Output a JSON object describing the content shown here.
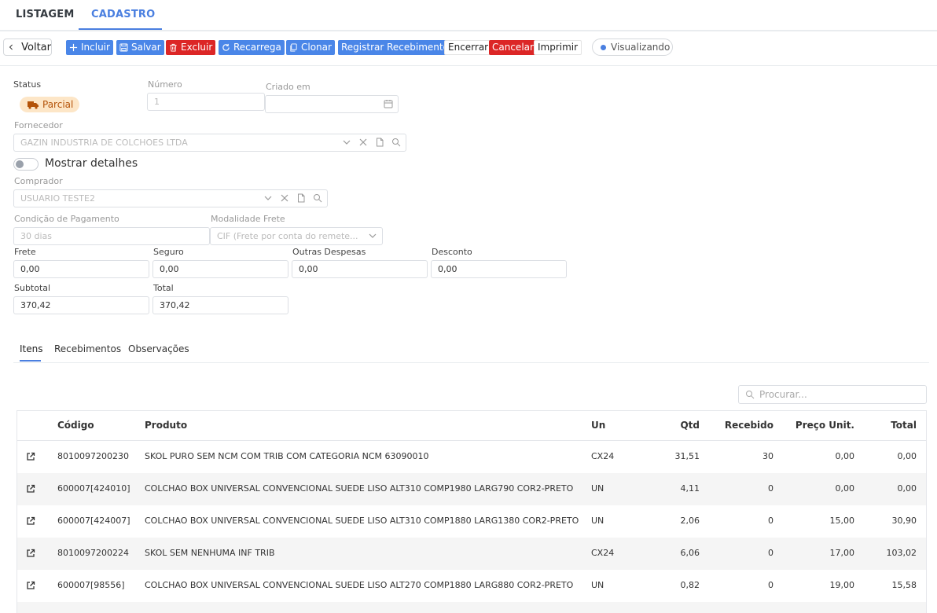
{
  "top_tabs": {
    "listagem": "LISTAGEM",
    "cadastro": "CADASTRO"
  },
  "toolbar": {
    "voltar": "Voltar",
    "incluir": "Incluir",
    "salvar": "Salvar",
    "excluir": "Excluir",
    "recarrega": "Recarrega",
    "clonar": "Clonar",
    "registrar": "Registrar Recebimento",
    "encerrar": "Encerrar",
    "cancelar": "Cancelar",
    "imprimir": "Imprimir",
    "mode": "Visualizando"
  },
  "form": {
    "status_label": "Status",
    "status_value": "Parcial",
    "numero_label": "Número",
    "numero_value": "1",
    "criado_label": "Criado em",
    "criado_value": "",
    "fornecedor_label": "Fornecedor",
    "fornecedor_value": "GAZIN INDUSTRIA DE COLCHOES LTDA",
    "mostrar_detalhes": "Mostrar detalhes",
    "comprador_label": "Comprador",
    "comprador_value": "USUARIO TESTE2",
    "condicao_label": "Condição de Pagamento",
    "condicao_value": "30 dias",
    "modalidade_label": "Modalidade Frete",
    "modalidade_value": "CIF (Frete por conta do remete...",
    "frete_label": "Frete",
    "frete_value": "0,00",
    "seguro_label": "Seguro",
    "seguro_value": "0,00",
    "outras_label": "Outras Despesas",
    "outras_value": "0,00",
    "desconto_label": "Desconto",
    "desconto_value": "0,00",
    "subtotal_label": "Subtotal",
    "subtotal_value": "370,42",
    "total_label": "Total",
    "total_value": "370,42"
  },
  "sub_tabs": {
    "itens": "Itens",
    "recebimentos": "Recebimentos",
    "observacoes": "Observações"
  },
  "search": {
    "placeholder": "Procurar..."
  },
  "table": {
    "headers": {
      "codigo": "Código",
      "produto": "Produto",
      "un": "Un",
      "qtd": "Qtd",
      "recebido": "Recebido",
      "preco": "Preço Unit.",
      "total": "Total"
    },
    "rows": [
      {
        "codigo": "8010097200230",
        "produto": "SKOL PURO SEM NCM COM TRIB COM CATEGORIA NCM 63090010",
        "un": "CX24",
        "qtd": "31,51",
        "recebido": "30",
        "preco": "0,00",
        "total": "0,00"
      },
      {
        "codigo": "600007[424010]",
        "produto": "COLCHAO BOX UNIVERSAL CONVENCIONAL SUEDE LISO ALT310 COMP1980 LARG790 COR2-PRETO",
        "un": "UN",
        "qtd": "4,11",
        "recebido": "0",
        "preco": "0,00",
        "total": "0,00"
      },
      {
        "codigo": "600007[424007]",
        "produto": "COLCHAO BOX UNIVERSAL CONVENCIONAL SUEDE LISO ALT310 COMP1880 LARG1380 COR2-PRETO",
        "un": "UN",
        "qtd": "2,06",
        "recebido": "0",
        "preco": "15,00",
        "total": "30,90"
      },
      {
        "codigo": "8010097200224",
        "produto": "SKOL SEM NENHUMA INF TRIB",
        "un": "CX24",
        "qtd": "6,06",
        "recebido": "0",
        "preco": "17,00",
        "total": "103,02"
      },
      {
        "codigo": "600007[98556]",
        "produto": "COLCHAO BOX UNIVERSAL CONVENCIONAL SUEDE LISO ALT270 COMP1880 LARG880 COR2-PRETO",
        "un": "UN",
        "qtd": "0,82",
        "recebido": "0",
        "preco": "19,00",
        "total": "15,58"
      }
    ]
  }
}
